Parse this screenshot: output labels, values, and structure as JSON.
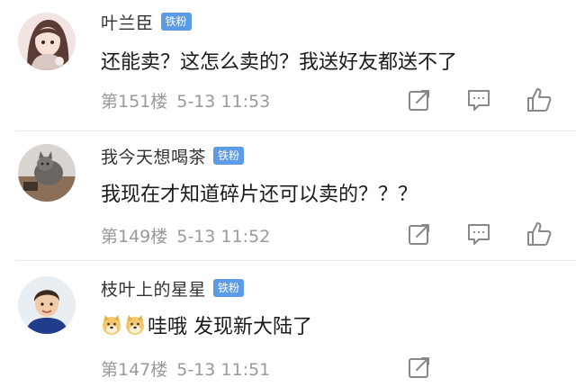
{
  "comments": [
    {
      "username": "叶兰臣",
      "badge": "铁粉",
      "text": "还能卖？这怎么卖的？我送好友都送不了",
      "floor": "第151楼",
      "time": "5-13 11:53"
    },
    {
      "username": "我今天想喝茶",
      "badge": "铁粉",
      "text": "我现在才知道碎片还可以卖的？？？",
      "floor": "第149楼",
      "time": "5-13 11:52"
    },
    {
      "username": "枝叶上的星星",
      "badge": "铁粉",
      "text": "哇哦 发现新大陆了",
      "floor": "第147楼",
      "time": "5-13 11:51"
    }
  ],
  "icons": {
    "share": "share-icon",
    "reply": "comment-icon",
    "like": "thumbs-up-icon",
    "emoji": "doge-emoji-icon"
  },
  "colors": {
    "badge": "#5c9ce6",
    "icon": "#888888",
    "meta_text": "#9a9a9a"
  }
}
